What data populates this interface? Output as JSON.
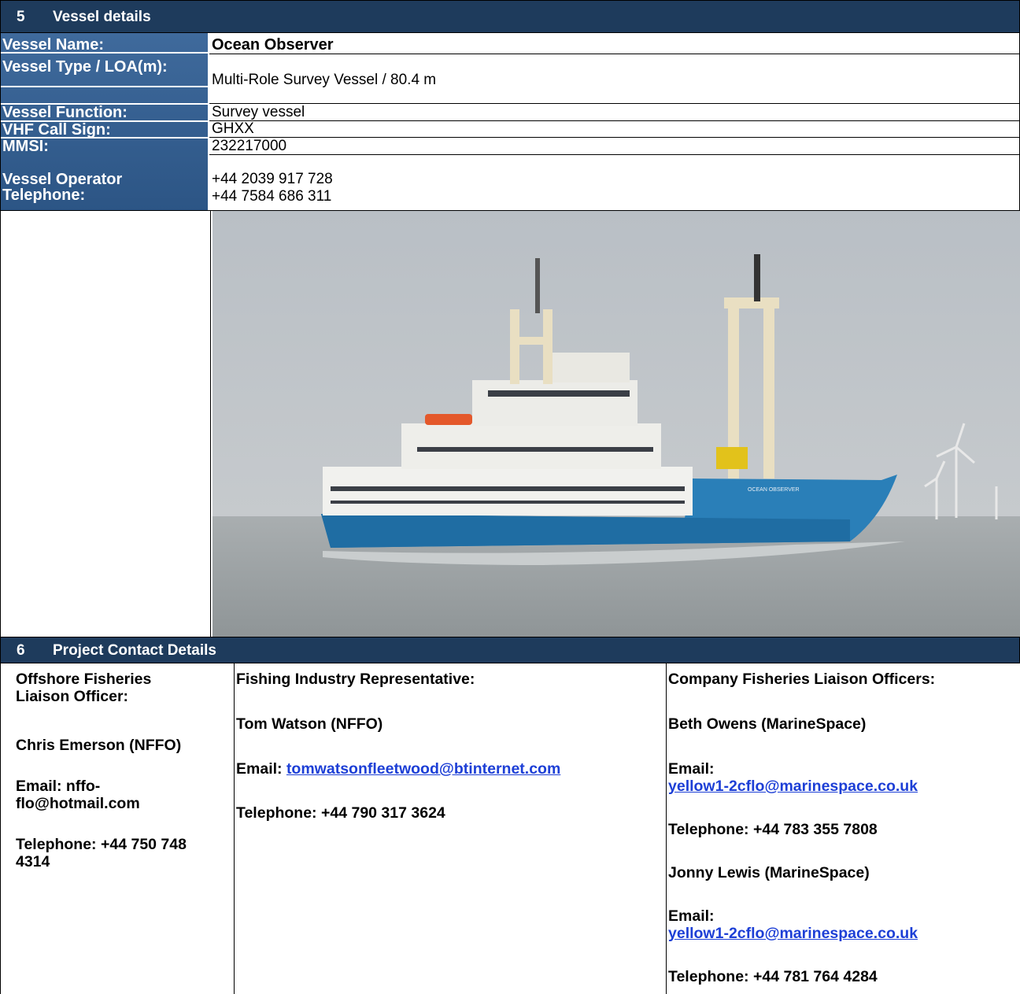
{
  "section5": {
    "number": "5",
    "title": "Vessel details",
    "rows": [
      {
        "label": "Vessel Name:",
        "value": "Ocean Observer"
      },
      {
        "label": "Vessel Type / LOA(m):",
        "value": "Multi-Role Survey Vessel / 80.4 m"
      },
      {
        "label": "Vessel Function:",
        "value": "Survey vessel"
      },
      {
        "label": "VHF Call Sign:",
        "value": "GHXX"
      },
      {
        "label": "MMSI:",
        "value": "232217000"
      },
      {
        "label": "Vessel Operator Telephone:",
        "value_line1": "+44 2039 917 728",
        "value_line2": "+44 7584 686 311"
      }
    ],
    "photo": {
      "hull_name": "OCEAN OBSERVER"
    }
  },
  "section6": {
    "number": "6",
    "title": "Project Contact Details",
    "col1": {
      "heading": "Offshore Fisheries Liaison Officer:",
      "name": "Chris Emerson (NFFO)",
      "email_line": "Email: nffo-flo@hotmail.com",
      "telephone": "Telephone: +44 750 748 4314"
    },
    "col2": {
      "heading": "Fishing Industry Representative:",
      "name": "Tom Watson (NFFO)",
      "email_label": "Email: ",
      "email": "tomwatsonfleetwood@btinternet.com",
      "telephone": "Telephone: +44 790 317 3624"
    },
    "col3": {
      "heading": "Company Fisheries Liaison Officers:",
      "contact1_name": "Beth Owens (MarineSpace)",
      "contact1_email_label": "Email:",
      "contact1_email": "yellow1-2cflo@marinespace.co.uk",
      "contact1_telephone": "Telephone: +44 783 355 7808",
      "contact2_name": "Jonny Lewis (MarineSpace)",
      "contact2_email_label": "Email:",
      "contact2_email": "yellow1-2cflo@marinespace.co.uk",
      "contact2_telephone": "Telephone: +44 781 764 4284"
    }
  }
}
